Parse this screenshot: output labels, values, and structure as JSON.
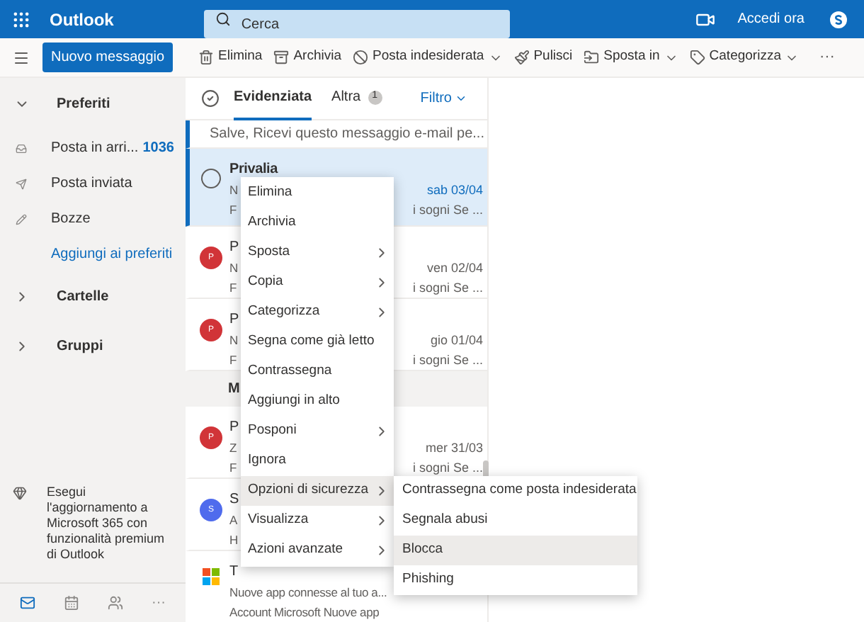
{
  "topbar": {
    "app_name": "Outlook",
    "search": {
      "placeholder": "Cerca"
    },
    "signin": "Accedi ora"
  },
  "toolbar": {
    "new_button": "Nuovo messaggio",
    "actions": [
      {
        "kind": "delete",
        "label": "Elimina",
        "dropdown": false
      },
      {
        "kind": "archive",
        "label": "Archivia",
        "dropdown": false
      },
      {
        "kind": "junk",
        "label": "Posta indesiderata",
        "dropdown": true
      },
      {
        "kind": "sweep",
        "label": "Pulisci",
        "dropdown": false
      },
      {
        "kind": "move",
        "label": "Sposta in",
        "dropdown": true
      },
      {
        "kind": "tag",
        "label": "Categorizza",
        "dropdown": true
      }
    ],
    "more": "···"
  },
  "sidebar": {
    "favorites": {
      "label": "Preferiti",
      "expanded": true,
      "items": [
        {
          "kind": "inbox",
          "label": "Posta in arri...",
          "count": "1036"
        },
        {
          "kind": "sent",
          "label": "Posta inviata"
        },
        {
          "kind": "drafts",
          "label": "Bozze"
        },
        {
          "kind": "link",
          "label": "Aggiungi ai preferiti"
        }
      ]
    },
    "sections": [
      {
        "label": "Cartelle",
        "expanded": false
      },
      {
        "label": "Gruppi",
        "expanded": false
      }
    ],
    "upgrade": "Esegui l'aggiornamento a Microsoft 365 con funzionalità premium di Outlook",
    "bottom_nav": [
      {
        "kind": "mail",
        "selected": true
      },
      {
        "kind": "calendar",
        "selected": false
      },
      {
        "kind": "people",
        "selected": false
      },
      {
        "kind": "more",
        "label": "···",
        "selected": false
      }
    ]
  },
  "message_list": {
    "tabs": [
      {
        "label": "Evidenziata",
        "selected": true
      },
      {
        "label": "Altra",
        "selected": false,
        "badge": "1"
      }
    ],
    "filter": "Filtro",
    "rows": [
      {
        "kind": "preview",
        "lines": [
          "Salve, Ricevi questo messaggio e-mail pe..."
        ],
        "unread": true,
        "selected": false
      },
      {
        "kind": "message",
        "avatar": {
          "kind": "radio"
        },
        "lines": [
          "Privalia",
          "N",
          "F"
        ],
        "date": "sab 03/04",
        "snippet": "i sogni Se ...",
        "unread": true,
        "selected": true
      },
      {
        "kind": "message",
        "avatar": {
          "kind": "letter",
          "letter": "P",
          "color": "#d13438"
        },
        "lines": [
          "P",
          "N",
          "F"
        ],
        "date": "ven 02/04",
        "snippet": "i sogni Se ...",
        "unread": false,
        "selected": false
      },
      {
        "kind": "message",
        "avatar": {
          "kind": "letter",
          "letter": "P",
          "color": "#d13438"
        },
        "lines": [
          "P",
          "N",
          "F"
        ],
        "date": "gio 01/04",
        "snippet": "i sogni Se ...",
        "unread": false,
        "selected": false
      },
      {
        "kind": "group",
        "lines": [
          "M"
        ]
      },
      {
        "kind": "message",
        "avatar": {
          "kind": "letter",
          "letter": "P",
          "color": "#d13438"
        },
        "lines": [
          "P",
          "Z",
          "F"
        ],
        "date": "mer 31/03",
        "snippet": "i sogni Se ...",
        "unread": false,
        "selected": false
      },
      {
        "kind": "message",
        "avatar": {
          "kind": "letter",
          "letter": "S",
          "color": "#4f6bed"
        },
        "lines": [
          "S",
          "A",
          "H"
        ],
        "unread": false,
        "selected": false
      },
      {
        "kind": "message",
        "avatar": {
          "kind": "logo"
        },
        "lines": [
          "T",
          "Nuove app connesse al tuo a...",
          "Account Microsoft Nuove app"
        ],
        "unread": false,
        "selected": false
      }
    ]
  },
  "context_menu": {
    "items": [
      {
        "label": "Elimina",
        "submenu": false,
        "selected": false
      },
      {
        "label": "Archivia",
        "submenu": false,
        "selected": false
      },
      {
        "label": "Sposta",
        "submenu": true,
        "selected": false
      },
      {
        "label": "Copia",
        "submenu": true,
        "selected": false
      },
      {
        "label": "Categorizza",
        "submenu": true,
        "selected": false
      },
      {
        "label": "Segna come già letto",
        "submenu": false,
        "selected": false
      },
      {
        "label": "Contrassegna",
        "submenu": false,
        "selected": false
      },
      {
        "label": "Aggiungi in alto",
        "submenu": false,
        "selected": false
      },
      {
        "label": "Posponi",
        "submenu": true,
        "selected": false
      },
      {
        "label": "Ignora",
        "submenu": false,
        "selected": false
      },
      {
        "label": "Opzioni di sicurezza",
        "submenu": true,
        "selected": true
      },
      {
        "label": "Visualizza",
        "submenu": true,
        "selected": false
      },
      {
        "label": "Azioni avanzate",
        "submenu": true,
        "selected": false
      }
    ],
    "submenu": [
      {
        "label": "Contrassegna come posta indesiderata",
        "selected": false
      },
      {
        "label": "Segnala abusi",
        "selected": false
      },
      {
        "label": "Blocca",
        "selected": true
      },
      {
        "label": "Phishing",
        "selected": false
      }
    ]
  }
}
